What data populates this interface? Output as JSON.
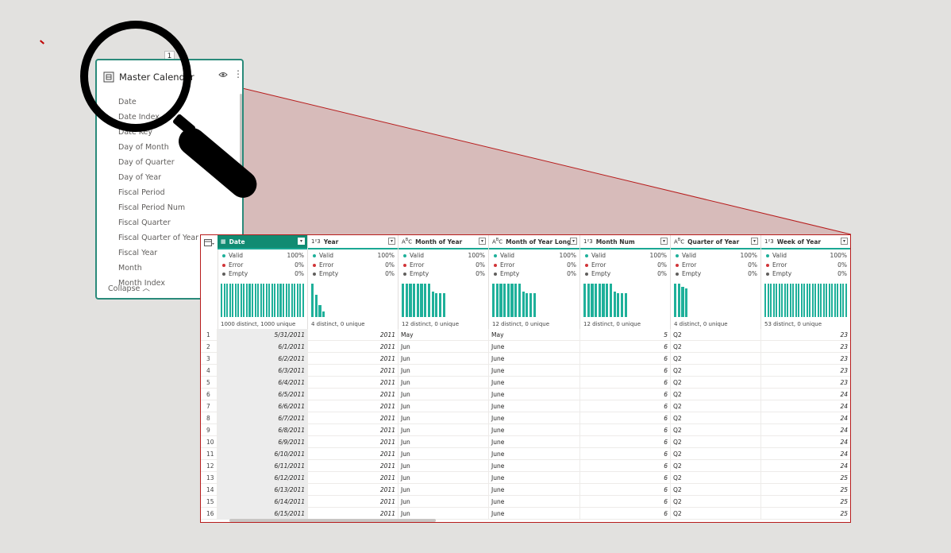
{
  "card": {
    "badge": "1",
    "title": "Master Calendar",
    "fields": [
      "Date",
      "Date Index",
      "Date Key",
      "Day of Month",
      "Day of Quarter",
      "Day of Year",
      "Fiscal Period",
      "Fiscal Period Num",
      "Fiscal Quarter",
      "Fiscal Quarter of Year",
      "Fiscal Year",
      "Month",
      "Month Index"
    ],
    "collapse_label": "Collapse"
  },
  "grid": {
    "accent": "#1fb09a",
    "columns": [
      {
        "type": "date",
        "name": "Date",
        "valid": "100%",
        "error": "0%",
        "empty": "0%",
        "distinct": "1000 distinct, 1000 unique",
        "bars": [
          1,
          1,
          1,
          1,
          1,
          1,
          1,
          1,
          1,
          1,
          1,
          1,
          1,
          1,
          1,
          1,
          1,
          1,
          1,
          1,
          1,
          1,
          1,
          1,
          1,
          1,
          1,
          1,
          1,
          1
        ]
      },
      {
        "type": "123",
        "name": "Year",
        "valid": "100%",
        "error": "0%",
        "empty": "0%",
        "distinct": "4 distinct, 0 unique",
        "bars": [
          1,
          0.65,
          0.35,
          0.15
        ]
      },
      {
        "type": "ABC",
        "name": "Month of Year",
        "valid": "100%",
        "error": "0%",
        "empty": "0%",
        "distinct": "12 distinct, 0 unique",
        "bars": [
          1,
          1,
          1,
          1,
          1,
          1,
          1,
          1,
          0.75,
          0.7,
          0.7,
          0.7
        ]
      },
      {
        "type": "ABC",
        "name": "Month of Year Long",
        "valid": "100%",
        "error": "0%",
        "empty": "0%",
        "distinct": "12 distinct, 0 unique",
        "bars": [
          1,
          1,
          1,
          1,
          1,
          1,
          1,
          1,
          0.75,
          0.7,
          0.7,
          0.7
        ]
      },
      {
        "type": "123",
        "name": "Month Num",
        "valid": "100%",
        "error": "0%",
        "empty": "0%",
        "distinct": "12 distinct, 0 unique",
        "bars": [
          1,
          1,
          1,
          1,
          1,
          1,
          1,
          1,
          0.75,
          0.7,
          0.7,
          0.7
        ]
      },
      {
        "type": "ABC",
        "name": "Quarter of Year",
        "valid": "100%",
        "error": "0%",
        "empty": "0%",
        "distinct": "4 distinct, 0 unique",
        "bars": [
          1,
          1,
          0.9,
          0.85
        ]
      },
      {
        "type": "123",
        "name": "Week of Year",
        "valid": "100%",
        "error": "0%",
        "empty": "0%",
        "distinct": "53 distinct, 0 unique",
        "bars": [
          1,
          1,
          1,
          1,
          1,
          1,
          1,
          1,
          1,
          1,
          1,
          1,
          1,
          1,
          1,
          1,
          1,
          1,
          1,
          1,
          1,
          1,
          1,
          1,
          1,
          1,
          1,
          1,
          1,
          1
        ]
      }
    ],
    "stat_labels": {
      "valid": "Valid",
      "error": "Error",
      "empty": "Empty"
    },
    "rows": [
      [
        "1",
        "5/31/2011",
        "2011",
        "May",
        "May",
        "5",
        "Q2",
        "23"
      ],
      [
        "2",
        "6/1/2011",
        "2011",
        "Jun",
        "June",
        "6",
        "Q2",
        "23"
      ],
      [
        "3",
        "6/2/2011",
        "2011",
        "Jun",
        "June",
        "6",
        "Q2",
        "23"
      ],
      [
        "4",
        "6/3/2011",
        "2011",
        "Jun",
        "June",
        "6",
        "Q2",
        "23"
      ],
      [
        "5",
        "6/4/2011",
        "2011",
        "Jun",
        "June",
        "6",
        "Q2",
        "23"
      ],
      [
        "6",
        "6/5/2011",
        "2011",
        "Jun",
        "June",
        "6",
        "Q2",
        "24"
      ],
      [
        "7",
        "6/6/2011",
        "2011",
        "Jun",
        "June",
        "6",
        "Q2",
        "24"
      ],
      [
        "8",
        "6/7/2011",
        "2011",
        "Jun",
        "June",
        "6",
        "Q2",
        "24"
      ],
      [
        "9",
        "6/8/2011",
        "2011",
        "Jun",
        "June",
        "6",
        "Q2",
        "24"
      ],
      [
        "10",
        "6/9/2011",
        "2011",
        "Jun",
        "June",
        "6",
        "Q2",
        "24"
      ],
      [
        "11",
        "6/10/2011",
        "2011",
        "Jun",
        "June",
        "6",
        "Q2",
        "24"
      ],
      [
        "12",
        "6/11/2011",
        "2011",
        "Jun",
        "June",
        "6",
        "Q2",
        "24"
      ],
      [
        "13",
        "6/12/2011",
        "2011",
        "Jun",
        "June",
        "6",
        "Q2",
        "25"
      ],
      [
        "14",
        "6/13/2011",
        "2011",
        "Jun",
        "June",
        "6",
        "Q2",
        "25"
      ],
      [
        "15",
        "6/14/2011",
        "2011",
        "Jun",
        "June",
        "6",
        "Q2",
        "25"
      ],
      [
        "16",
        "6/15/2011",
        "2011",
        "Jun",
        "June",
        "6",
        "Q2",
        "25"
      ]
    ]
  }
}
